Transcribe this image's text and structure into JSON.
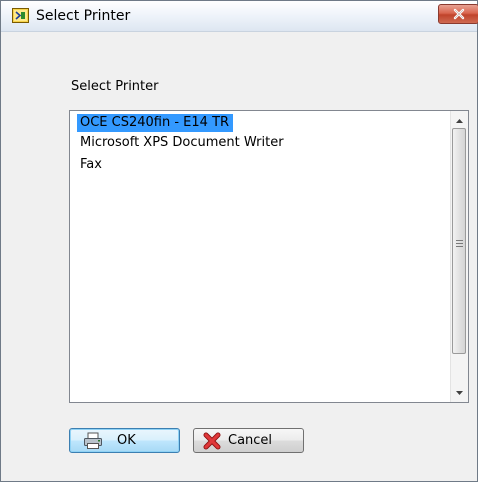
{
  "window": {
    "title": "Select Printer",
    "close_icon": "close-icon"
  },
  "content": {
    "list_label": "Select Printer",
    "printers": [
      {
        "label": "OCE CS240fin - E14 TR",
        "selected": true
      },
      {
        "label": "Microsoft XPS Document Writer",
        "selected": false
      },
      {
        "label": "Fax",
        "selected": false
      }
    ]
  },
  "buttons": {
    "ok": {
      "label": "OK",
      "icon": "printer-icon"
    },
    "cancel": {
      "label": "Cancel",
      "icon": "cancel-x-icon"
    }
  },
  "colors": {
    "selection": "#3399ff",
    "close_button": "#c94a33"
  }
}
